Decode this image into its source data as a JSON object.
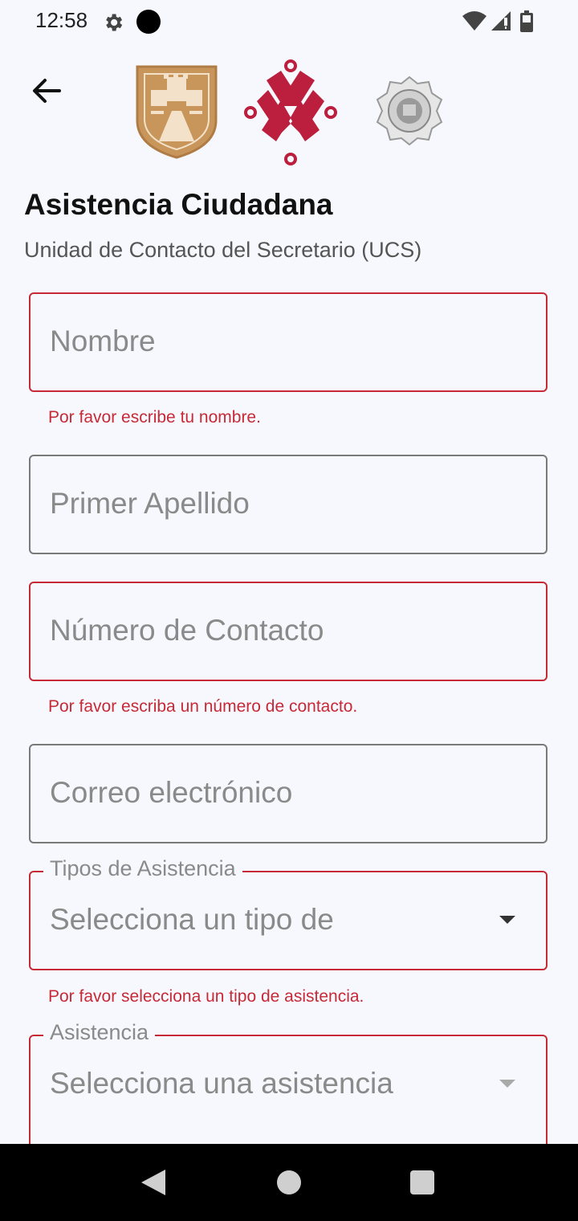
{
  "status_bar": {
    "time": "12:58"
  },
  "header": {
    "title": "Asistencia Ciudadana",
    "subtitle": "Unidad de Contacto del Secretario (UCS)"
  },
  "form": {
    "nombre": {
      "placeholder": "Nombre",
      "error": "Por favor escribe tu nombre."
    },
    "apellido": {
      "placeholder": "Primer Apellido"
    },
    "contacto": {
      "placeholder": "Número de Contacto",
      "error": "Por favor escriba un número de contacto."
    },
    "correo": {
      "placeholder": "Correo electrónico"
    },
    "tipo": {
      "label": "Tipos de Asistencia",
      "placeholder": "Selecciona un tipo de",
      "error": "Por favor selecciona un tipo de asistencia."
    },
    "asistencia": {
      "label": "Asistencia",
      "placeholder": "Selecciona una asistencia"
    }
  },
  "colors": {
    "error": "#c62a37",
    "background": "#f7f8fd",
    "gold": "#c8965b",
    "crimson": "#bc1f3d"
  },
  "icons": [
    "settings-icon",
    "wifi-icon",
    "signal-icon",
    "battery-icon",
    "back-arrow-icon",
    "dropdown-arrow-icon"
  ]
}
